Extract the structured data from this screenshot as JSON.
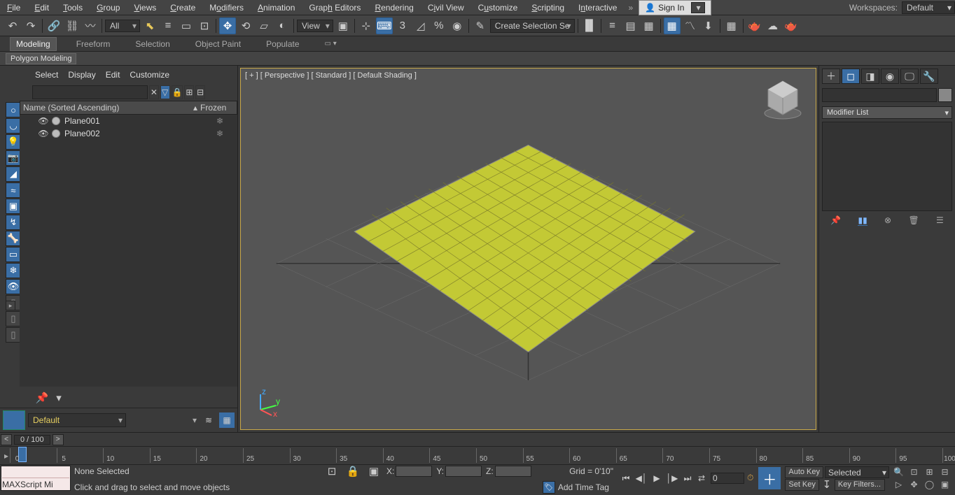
{
  "menus": [
    "File",
    "Edit",
    "Tools",
    "Group",
    "Views",
    "Create",
    "Modifiers",
    "Animation",
    "Graph Editors",
    "Rendering",
    "Civil View",
    "Customize",
    "Scripting",
    "Interactive"
  ],
  "signin": "Sign In",
  "workspaces_label": "Workspaces:",
  "workspace": "Default",
  "toolbar": {
    "filter_sel": "All",
    "view_sel": "View",
    "named_sel": "Create Selection Se"
  },
  "ribbon_tabs": [
    "Modeling",
    "Freeform",
    "Selection",
    "Object Paint",
    "Populate"
  ],
  "subribbon": "Polygon Modeling",
  "scene_explorer": {
    "menus": [
      "Select",
      "Display",
      "Edit",
      "Customize"
    ],
    "col_name": "Name (Sorted Ascending)",
    "col_frozen": "Frozen",
    "items": [
      {
        "name": "Plane001"
      },
      {
        "name": "Plane002"
      }
    ]
  },
  "viewport_label": "[ + ] [ Perspective ] [ Standard ] [ Default Shading ]",
  "modifier_list": "Modifier List",
  "layer": "Default",
  "track_pos": "0 / 100",
  "timeline_ticks": [
    "0",
    "5",
    "10",
    "15",
    "20",
    "25",
    "30",
    "35",
    "40",
    "45",
    "50",
    "55",
    "60",
    "65",
    "70",
    "75",
    "80",
    "85",
    "90",
    "95",
    "100"
  ],
  "status": {
    "selection": "None Selected",
    "prompt": "Click and drag to select and move objects",
    "script": "MAXScript Mi",
    "x": "X:",
    "y": "Y:",
    "z": "Z:",
    "grid": "Grid = 0'10\"",
    "addtag": "Add Time Tag",
    "autokey": "Auto Key",
    "setkey": "Set Key",
    "keymode": "Selected",
    "keyfilters": "Key Filters...",
    "curframe": "0"
  }
}
